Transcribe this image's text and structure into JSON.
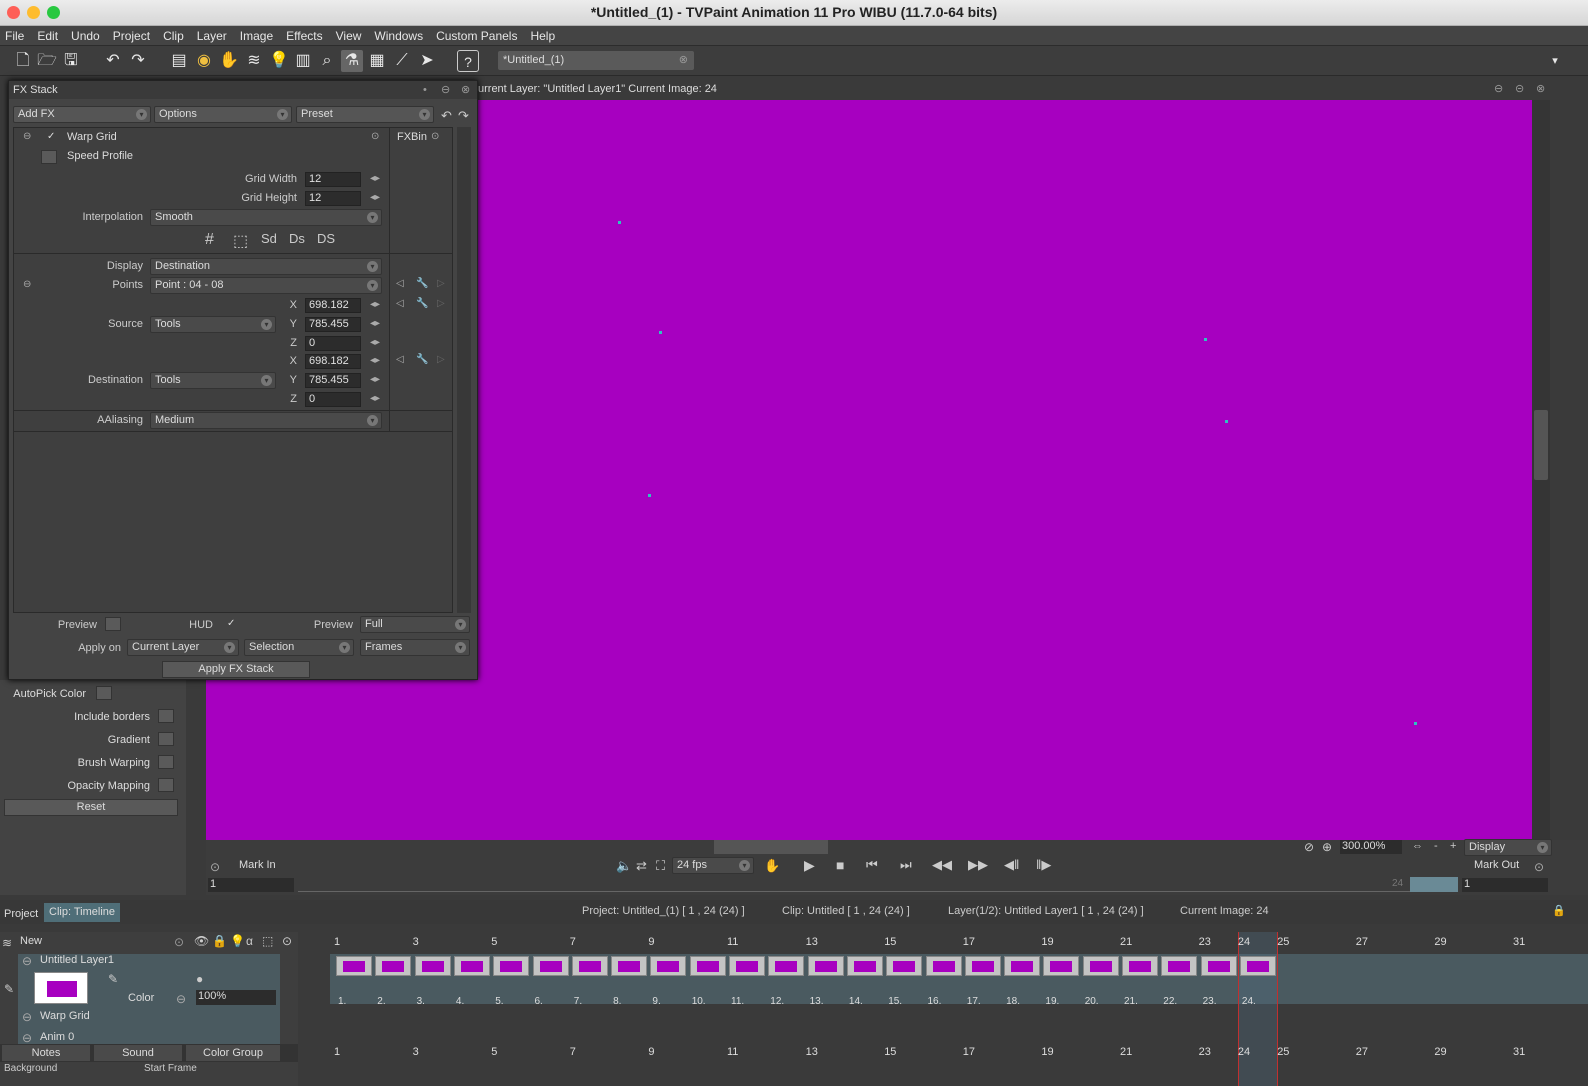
{
  "window": {
    "title": "*Untitled_(1) - TVPaint Animation 11 Pro WIBU (11.7.0-64 bits)"
  },
  "menu": [
    "File",
    "Edit",
    "Undo",
    "Project",
    "Clip",
    "Layer",
    "Image",
    "Effects",
    "View",
    "Windows",
    "Custom Panels",
    "Help"
  ],
  "doc_tab": "*Untitled_(1)",
  "view_header": "urrent Layer: \"Untitled Layer1\"  Current Image: 24",
  "fx": {
    "title": "FX Stack",
    "add_fx": "Add FX",
    "options": "Options",
    "preset": "Preset",
    "effect": "Warp Grid",
    "speed_profile": "Speed Profile",
    "fxbin": "FXBin",
    "grid_width_label": "Grid Width",
    "grid_width": "12",
    "grid_height_label": "Grid Height",
    "grid_height": "12",
    "interpolation_label": "Interpolation",
    "interpolation": "Smooth",
    "display_label": "Display",
    "display": "Destination",
    "points_label": "Points",
    "points": "Point : 04 - 08",
    "source_label": "Source",
    "source_mode": "Tools",
    "src_x": "698.182",
    "src_y": "785.455",
    "src_z": "0",
    "dest_label": "Destination",
    "dest_mode": "Tools",
    "dst_x": "698.182",
    "dst_y": "785.455",
    "dst_z": "0",
    "x": "X",
    "y": "Y",
    "z": "Z",
    "aaliasing_label": "AAliasing",
    "aaliasing": "Medium",
    "preview_label": "Preview",
    "hud_label": "HUD",
    "preview2_label": "Preview",
    "preview_mode": "Full",
    "apply_on_label": "Apply on",
    "apply_on": "Current Layer",
    "selection": "Selection",
    "frames": "Frames",
    "apply_button": "Apply FX Stack"
  },
  "left_panel": {
    "autopick": "AutoPick Color",
    "include_borders": "Include borders",
    "gradient": "Gradient",
    "brush_warping": "Brush Warping",
    "opacity_mapping": "Opacity Mapping",
    "reset": "Reset"
  },
  "playback": {
    "mark_in": "Mark In",
    "fps": "24 fps",
    "zoom": "300.00%",
    "display": "Display",
    "mark_out": "Mark Out",
    "start_frame": "1",
    "end_frame": "1",
    "cur": "24"
  },
  "timeline": {
    "tabs": [
      "Project",
      "Clip: Timeline"
    ],
    "project_info": "Project: Untitled_(1) [ 1 , 24  (24) ]",
    "clip_info": "Clip: Untitled [ 1 , 24  (24) ]",
    "layer_info": "Layer(1/2): Untitled Layer1 [ 1 , 24  (24) ]",
    "current_image": "Current Image: 24",
    "new_label": "New",
    "layer_name": "Untitled Layer1",
    "color_label": "Color",
    "opacity": "100%",
    "warp_grid": "Warp Grid",
    "anim": "Anim  0",
    "bottom_tabs": [
      "Notes",
      "Sound",
      "Color Group"
    ],
    "background": "Background",
    "start_frame": "Start Frame",
    "ruler": [
      "1",
      "3",
      "5",
      "7",
      "9",
      "11",
      "13",
      "15",
      "17",
      "19",
      "21",
      "23",
      "24",
      "25",
      "27",
      "29",
      "31"
    ],
    "frame_numbers": [
      "1.",
      "2.",
      "3.",
      "4.",
      "5.",
      "6.",
      "7.",
      "8.",
      "9.",
      "10.",
      "11.",
      "12.",
      "13.",
      "14.",
      "15.",
      "16.",
      "17.",
      "18.",
      "19.",
      "20.",
      "21.",
      "22.",
      "23.",
      "24."
    ]
  }
}
